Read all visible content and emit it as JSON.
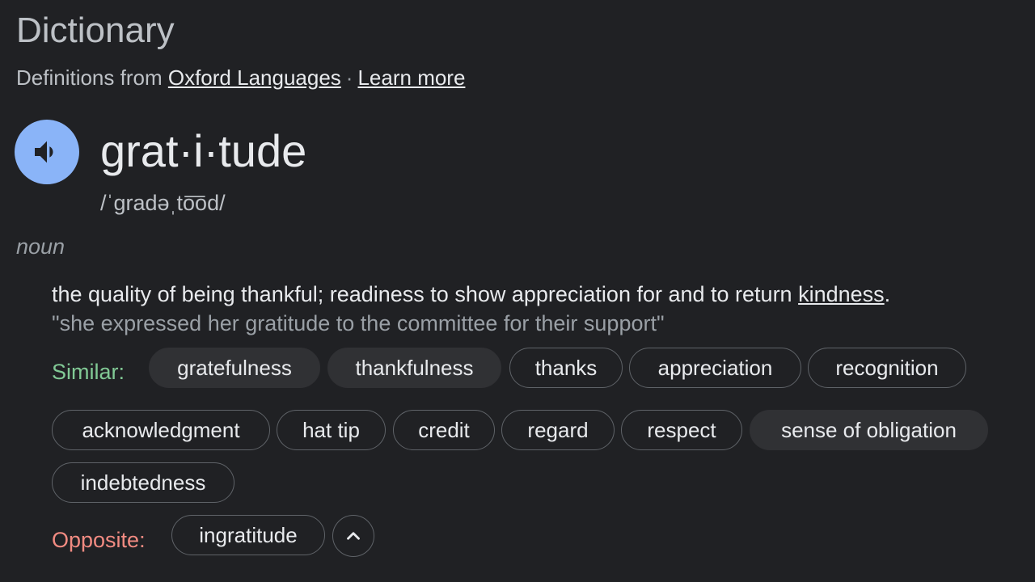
{
  "header": {
    "title": "Dictionary",
    "source_prefix": "Definitions from",
    "source_link": "Oxford Languages",
    "separator": "·",
    "learn_more": "Learn more"
  },
  "entry": {
    "word": "grat·i·tude",
    "phonetic": "/ˈɡradəˌto͞od/",
    "speaker_icon": "volume-icon",
    "part_of_speech": "noun",
    "definition_text": "the quality of being thankful; readiness to show appreciation for and to return ",
    "definition_link": "kindness",
    "definition_end": ".",
    "example": "\"she expressed her gratitude to the committee for their support\""
  },
  "similar": {
    "label": "Similar:",
    "chips": [
      "gratefulness",
      "thankfulness",
      "thanks",
      "appreciation",
      "recognition",
      "acknowledgment",
      "hat tip",
      "credit",
      "regard",
      "respect",
      "sense of obligation",
      "indebtedness"
    ]
  },
  "opposite": {
    "label": "Opposite:",
    "chips": [
      "ingratitude"
    ],
    "collapse_icon": "chevron-up-icon"
  },
  "colors": {
    "background": "#202124",
    "speaker": "#8ab4f8",
    "similar_label": "#81c995",
    "opposite_label": "#f28b82"
  }
}
